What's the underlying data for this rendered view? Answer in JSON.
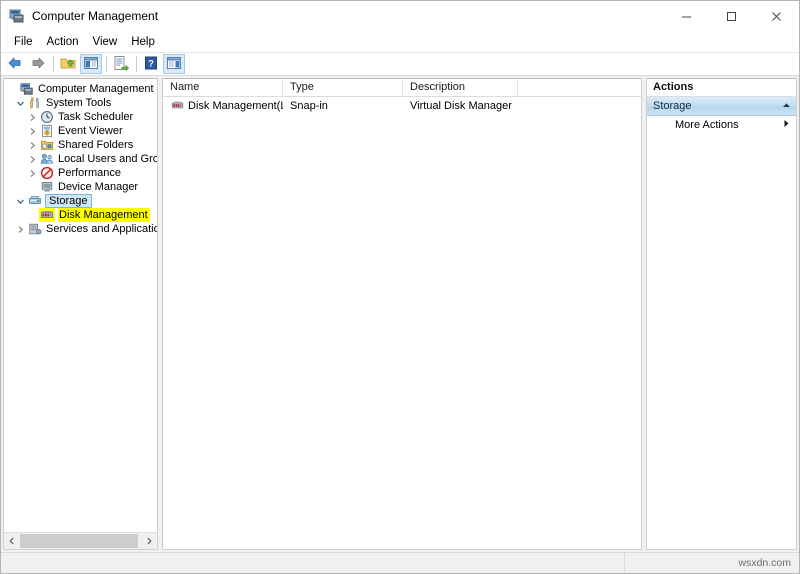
{
  "window": {
    "title": "Computer Management",
    "title_icon": "mmc-console-icon",
    "controls": {
      "minimize": "minimize-icon",
      "maximize": "maximize-icon",
      "close": "close-icon"
    }
  },
  "menubar": {
    "items": [
      {
        "label": "File"
      },
      {
        "label": "Action"
      },
      {
        "label": "View"
      },
      {
        "label": "Help"
      }
    ]
  },
  "toolbar": {
    "buttons": [
      {
        "name": "back-button",
        "icon": "arrow-left-icon",
        "enabled": true
      },
      {
        "name": "forward-button",
        "icon": "arrow-right-icon",
        "enabled": false
      },
      {
        "name": "up-one-level-button",
        "icon": "folder-up-icon",
        "enabled": true
      },
      {
        "name": "show-hide-console-tree-button",
        "icon": "console-tree-icon",
        "enabled": true,
        "active": true
      },
      {
        "name": "export-list-button",
        "icon": "export-list-icon",
        "enabled": true
      },
      {
        "name": "help-button",
        "icon": "help-question-icon",
        "enabled": true
      },
      {
        "name": "show-action-pane-button",
        "icon": "action-pane-icon",
        "enabled": true,
        "active": true
      }
    ]
  },
  "tree": {
    "items": [
      {
        "label": "Computer Management (Local",
        "icon": "computer-management-icon",
        "indent": 0,
        "expander": "none",
        "state": "normal"
      },
      {
        "label": "System Tools",
        "icon": "system-tools-icon",
        "indent": 1,
        "expander": "expanded",
        "state": "normal"
      },
      {
        "label": "Task Scheduler",
        "icon": "clock-icon",
        "indent": 2,
        "expander": "collapsed",
        "state": "normal"
      },
      {
        "label": "Event Viewer",
        "icon": "event-viewer-icon",
        "indent": 2,
        "expander": "collapsed",
        "state": "normal"
      },
      {
        "label": "Shared Folders",
        "icon": "shared-folders-icon",
        "indent": 2,
        "expander": "collapsed",
        "state": "normal"
      },
      {
        "label": "Local Users and Groups",
        "icon": "users-group-icon",
        "indent": 2,
        "expander": "collapsed",
        "state": "normal"
      },
      {
        "label": "Performance",
        "icon": "performance-icon",
        "indent": 2,
        "expander": "collapsed",
        "state": "normal"
      },
      {
        "label": "Device Manager",
        "icon": "device-manager-icon",
        "indent": 2,
        "expander": "none",
        "state": "normal"
      },
      {
        "label": "Storage",
        "icon": "storage-icon",
        "indent": 1,
        "expander": "expanded",
        "state": "selected"
      },
      {
        "label": "Disk Management",
        "icon": "disk-management-icon",
        "indent": 2,
        "expander": "none",
        "state": "highlighted"
      },
      {
        "label": "Services and Applications",
        "icon": "services-icon",
        "indent": 1,
        "expander": "collapsed",
        "state": "normal"
      }
    ],
    "scrollbar": {
      "left_arrow": "chevron-left-icon",
      "right_arrow": "chevron-right-icon"
    }
  },
  "list": {
    "columns": [
      {
        "label": "Name",
        "width": 120
      },
      {
        "label": "Type",
        "width": 120
      },
      {
        "label": "Description",
        "width": 115
      },
      {
        "label": "",
        "width": 125
      }
    ],
    "rows": [
      {
        "icon": "disk-management-icon",
        "name": "Disk Management(Lo...",
        "type": "Snap-in",
        "description": "Virtual Disk Manager",
        "extra": ""
      }
    ]
  },
  "actions": {
    "title": "Actions",
    "sections": [
      {
        "label": "Storage",
        "collapse_icon": "chevron-up-icon",
        "items": [
          {
            "label": "More Actions",
            "submenu_icon": "chevron-right-icon"
          }
        ]
      }
    ]
  },
  "statusbar": {
    "watermark": "wsxdn.com"
  },
  "colors": {
    "window_bg": "#f0f0f0",
    "pane_bg": "#ffffff",
    "selection_blue": "#cde8f6",
    "highlight_yellow": "#ffff00",
    "actions_header_blue": "#c3ddf0",
    "toolbar_active": "#d8eaf8",
    "border": "#cfcfcf"
  }
}
